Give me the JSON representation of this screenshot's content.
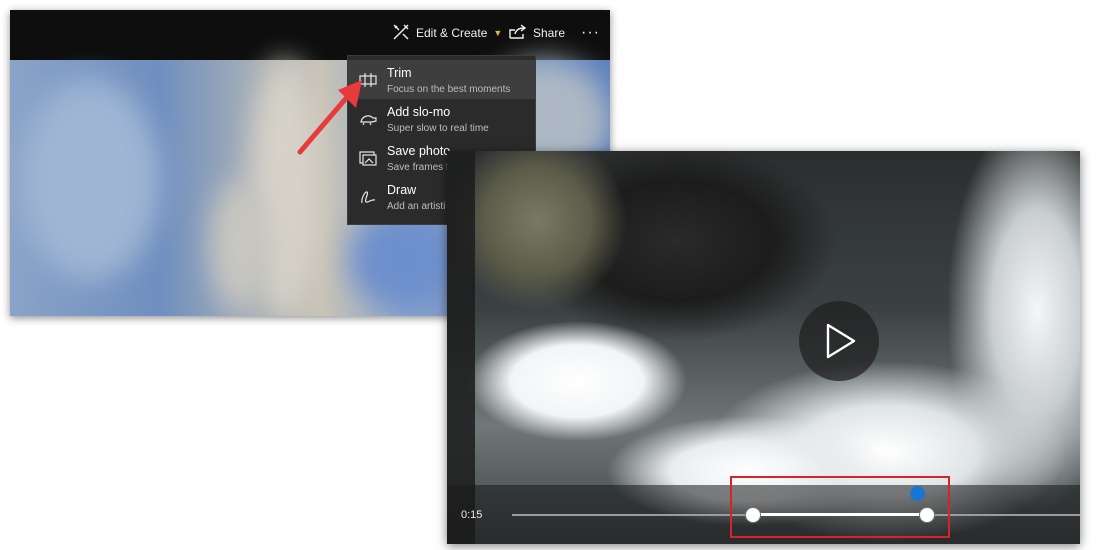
{
  "toolbar": {
    "edit_create_label": "Edit & Create",
    "share_label": "Share",
    "more_label": "···"
  },
  "menu": {
    "items": [
      {
        "label": "Trim",
        "description": "Focus on the best moments",
        "icon": "trim-icon",
        "selected": true
      },
      {
        "label": "Add slo-mo",
        "description": "Super slow to real time",
        "icon": "slo-mo-icon",
        "selected": false
      },
      {
        "label": "Save photo",
        "description": "Save frames f",
        "icon": "save-photo-icon",
        "selected": false
      },
      {
        "label": "Draw",
        "description": "Add an artisti",
        "icon": "draw-icon",
        "selected": false
      }
    ]
  },
  "video": {
    "current_time": "0:15",
    "icon": "play-icon"
  },
  "colors": {
    "menu_bg": "#2b2b2b",
    "accent_chevron": "#e3b34a",
    "playhead": "#1976d2",
    "annotation_red": "#d9232b"
  }
}
